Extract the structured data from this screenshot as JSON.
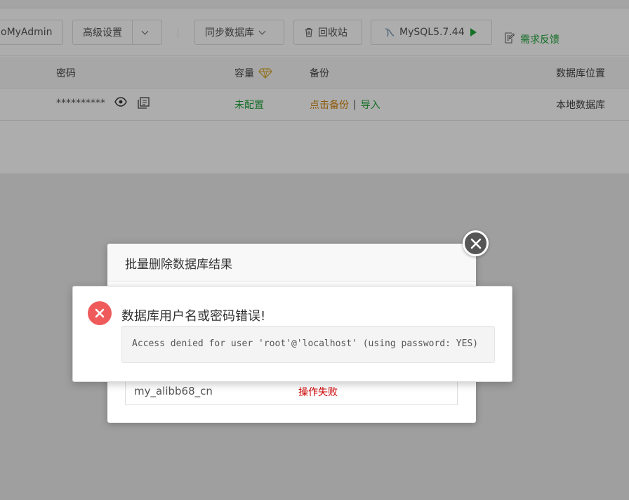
{
  "toolbar": {
    "phpmyadmin_label": "oMyAdmin",
    "advanced_label": "高级设置",
    "sync_label": "同步数据库",
    "recycle_label": "回收站",
    "mysql_label": "MySQL5.7.44",
    "feedback_label": "需求反馈"
  },
  "table": {
    "headers": {
      "password": "密码",
      "capacity": "容量",
      "backup": "备份",
      "location": "数据库位置"
    },
    "row": {
      "password_mask": "**********",
      "capacity": "未配置",
      "backup_action": "点击备份",
      "separator": "|",
      "import_action": "导入",
      "location": "本地数据库"
    }
  },
  "dialog": {
    "title": "批量删除数据库结果",
    "result": {
      "name": "my_alibb68_cn",
      "status": "操作失败"
    }
  },
  "alert": {
    "title": "数据库用户名或密码错误!",
    "message": "Access denied for user 'root'@'localhost' (using password: YES)"
  },
  "colors": {
    "accent_green": "#20a53a",
    "error_red": "#ef5b5b",
    "warning_orange": "#d38510"
  }
}
